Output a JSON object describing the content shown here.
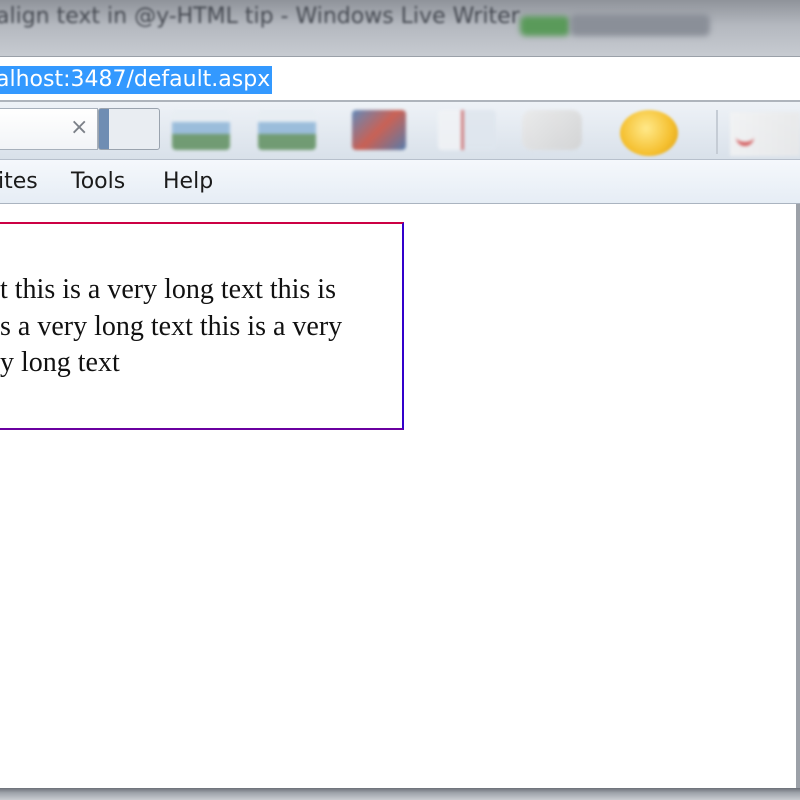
{
  "window": {
    "title": "align text in @y-HTML tip - Windows Live Writer"
  },
  "address_bar": {
    "url": "alhost:3487/default.aspx"
  },
  "toolbar": {
    "close_glyph": "×",
    "icons": [
      "picture-icon",
      "picture-icon",
      "picture-icon",
      "video-icon",
      "map-icon",
      "tag-icon",
      "emoticon-icon"
    ]
  },
  "menu": {
    "items": [
      "ites",
      "Tools",
      "Help"
    ]
  },
  "content": {
    "lines": [
      "t this is a very long text this is",
      "s a very long text this is a very",
      "y long text"
    ]
  },
  "colors": {
    "selection": "#3399ff",
    "box_border_left": "#cc0044",
    "box_border_right": "#3300cc"
  }
}
